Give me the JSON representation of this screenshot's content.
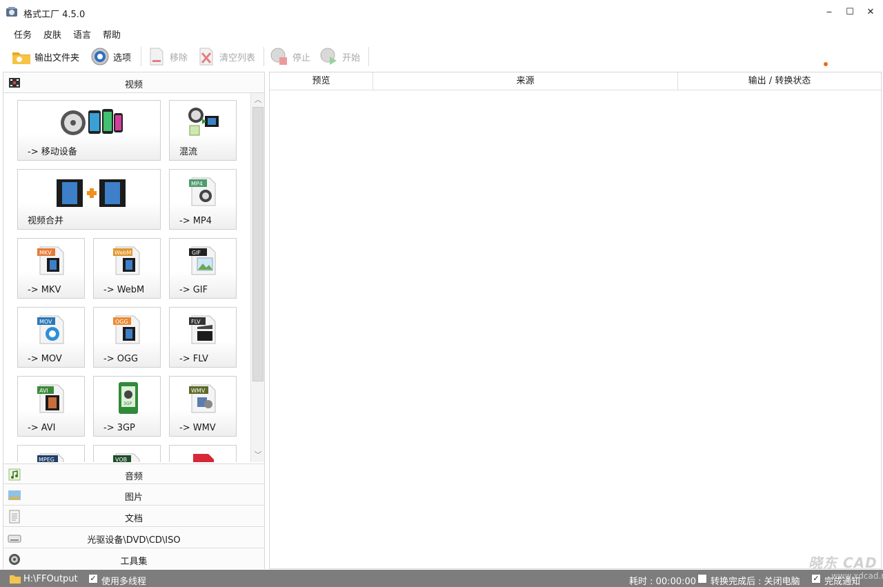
{
  "window": {
    "title": "格式工厂 4.5.0",
    "min": "‒",
    "max": "☐",
    "close": "✕"
  },
  "menu": [
    "任务",
    "皮肤",
    "语言",
    "帮助"
  ],
  "toolbar": {
    "output_folder": "输出文件夹",
    "options": "选项",
    "remove": "移除",
    "clear_list": "清空列表",
    "stop": "停止",
    "start": "开始"
  },
  "categories": {
    "video": "视频",
    "audio": "音频",
    "picture": "图片",
    "document": "文档",
    "rom": "光驱设备\\DVD\\CD\\ISO",
    "tools": "工具集"
  },
  "tiles": {
    "mobile": "-> 移动设备",
    "mux": "混流",
    "joiner": "视频合并",
    "mp4": "-> MP4",
    "mkv": "-> MKV",
    "webm": "-> WebM",
    "gif": "-> GIF",
    "mov": "-> MOV",
    "ogg": "-> OGG",
    "flv": "-> FLV",
    "avi": "-> AVI",
    "3gp": "-> 3GP",
    "wmv": "-> WMV"
  },
  "tile_badges": {
    "mp4": "MP4",
    "mkv": "MKV",
    "webm": "WebM",
    "gif": "GIF",
    "mov": "MOV",
    "ogg": "OGG",
    "flv": "FLV",
    "avi": "AVI",
    "3gp": "3GP",
    "wmv": "WMV",
    "mpeg": "MPEG",
    "vob": "VOB"
  },
  "columns": [
    "预览",
    "来源",
    "输出 / 转换状态"
  ],
  "status": {
    "output_path": "H:\\FFOutput",
    "multithread": "使用多线程",
    "elapsed": "耗时 : 00:00:00",
    "after_done": "转换完成后 : 关闭电脑",
    "notify": "完成通知",
    "check": "✓"
  },
  "watermark": {
    "brand": "晓东 CAD",
    "site": "www.xdcad.net"
  },
  "colors": {
    "accent": "#ec6a1c",
    "statusbar": "#7d7d7d"
  }
}
